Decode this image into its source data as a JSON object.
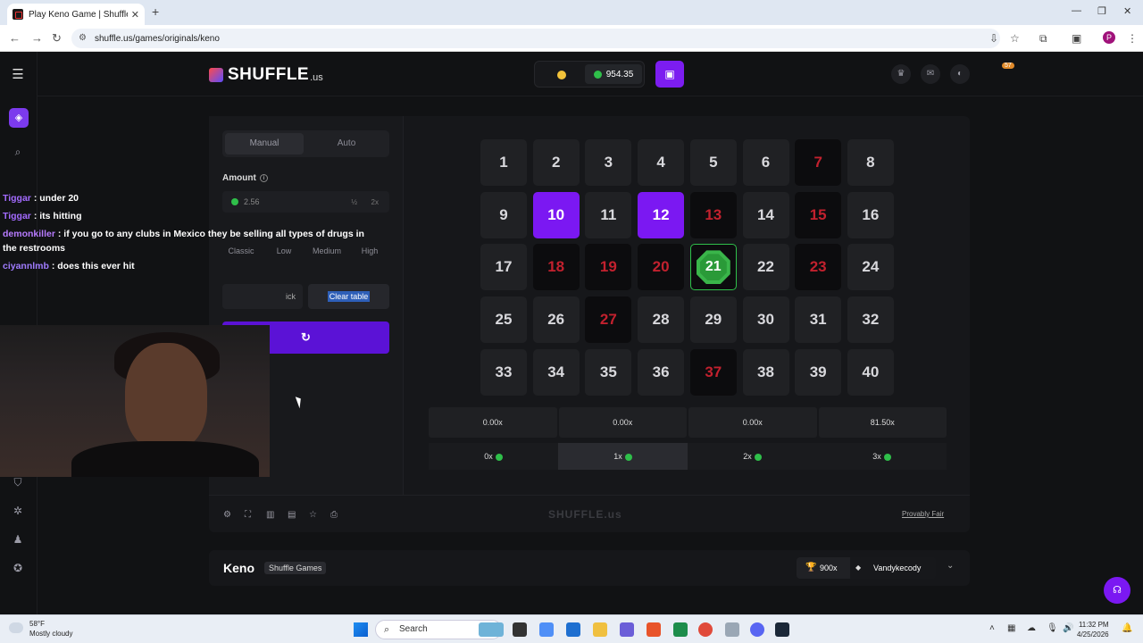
{
  "browser": {
    "tab_title": "Play Keno Game | Shuffle.us",
    "url": "shuffle.us/games/originals/keno"
  },
  "header": {
    "logo_word": "SHUFFLE",
    "logo_tld": ".us",
    "balance": "954.35",
    "notification_count": "57"
  },
  "controls": {
    "tab_manual": "Manual",
    "tab_auto": "Auto",
    "amount_label": "Amount",
    "amount_value": "2.56",
    "half_label": "½",
    "double_label": "2x",
    "risk_options": [
      "Classic",
      "Low",
      "Medium",
      "High"
    ],
    "quick_pick_label": "ick",
    "clear_table_label": "Clear table"
  },
  "board": {
    "tiles": [
      {
        "n": "1",
        "s": "normal"
      },
      {
        "n": "2",
        "s": "normal"
      },
      {
        "n": "3",
        "s": "normal"
      },
      {
        "n": "4",
        "s": "normal"
      },
      {
        "n": "5",
        "s": "normal"
      },
      {
        "n": "6",
        "s": "normal"
      },
      {
        "n": "7",
        "s": "miss"
      },
      {
        "n": "8",
        "s": "normal"
      },
      {
        "n": "9",
        "s": "normal"
      },
      {
        "n": "10",
        "s": "picked"
      },
      {
        "n": "11",
        "s": "normal"
      },
      {
        "n": "12",
        "s": "picked"
      },
      {
        "n": "13",
        "s": "miss"
      },
      {
        "n": "14",
        "s": "normal"
      },
      {
        "n": "15",
        "s": "miss"
      },
      {
        "n": "16",
        "s": "normal"
      },
      {
        "n": "17",
        "s": "normal"
      },
      {
        "n": "18",
        "s": "miss"
      },
      {
        "n": "19",
        "s": "miss"
      },
      {
        "n": "20",
        "s": "miss"
      },
      {
        "n": "21",
        "s": "hit"
      },
      {
        "n": "22",
        "s": "normal"
      },
      {
        "n": "23",
        "s": "miss"
      },
      {
        "n": "24",
        "s": "normal"
      },
      {
        "n": "25",
        "s": "normal"
      },
      {
        "n": "26",
        "s": "normal"
      },
      {
        "n": "27",
        "s": "miss"
      },
      {
        "n": "28",
        "s": "normal"
      },
      {
        "n": "29",
        "s": "normal"
      },
      {
        "n": "30",
        "s": "normal"
      },
      {
        "n": "31",
        "s": "normal"
      },
      {
        "n": "32",
        "s": "normal"
      },
      {
        "n": "33",
        "s": "normal"
      },
      {
        "n": "34",
        "s": "normal"
      },
      {
        "n": "35",
        "s": "normal"
      },
      {
        "n": "36",
        "s": "normal"
      },
      {
        "n": "37",
        "s": "miss"
      },
      {
        "n": "38",
        "s": "normal"
      },
      {
        "n": "39",
        "s": "normal"
      },
      {
        "n": "40",
        "s": "normal"
      }
    ],
    "payouts": [
      "0.00x",
      "0.00x",
      "0.00x",
      "81.50x"
    ],
    "hits": [
      "0x",
      "1x",
      "2x",
      "3x"
    ]
  },
  "footer": {
    "watermark": "SHUFFLE.us",
    "provably_fair": "Provably Fair"
  },
  "info": {
    "game_title": "Keno",
    "provider": "Shuffle Games",
    "top_multiplier": "900x",
    "top_user": "Vandykecody"
  },
  "chat": [
    {
      "user": "Tiggar",
      "msg": ": under 20"
    },
    {
      "user": "Tiggar",
      "msg": ": its hitting"
    },
    {
      "user": "demonkiller",
      "msg": ": if you go to any clubs in Mexico they be selling all types of drugs in"
    },
    {
      "user": "",
      "msg": "the restrooms"
    },
    {
      "user": "ciyannlmb",
      "msg": ": does this ever hit"
    }
  ],
  "taskbar": {
    "temp": "58°F",
    "weather": "Mostly cloudy",
    "search": "Search",
    "time": "11:32 PM",
    "date": "4/25/2026"
  }
}
